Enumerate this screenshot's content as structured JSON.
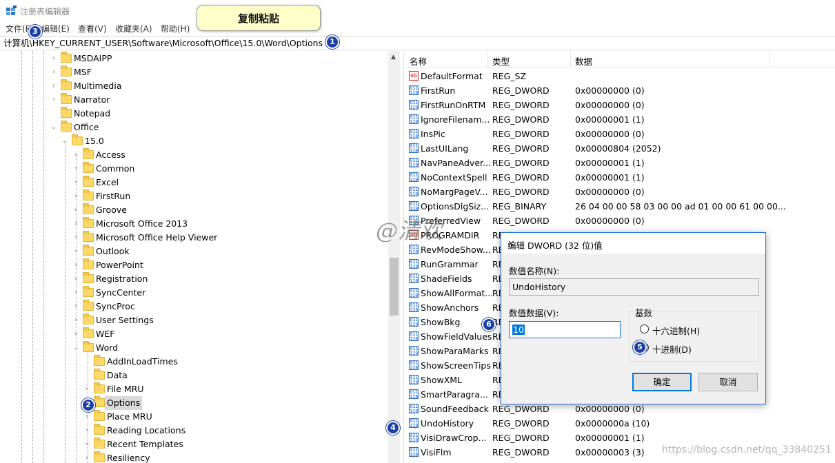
{
  "window": {
    "title": "注册表编辑器"
  },
  "menu": [
    "文件(F)",
    "编辑(E)",
    "查看(V)",
    "收藏夹(A)",
    "帮助(H)"
  ],
  "callout": "复制粘贴",
  "address": "计算机\\HKEY_CURRENT_USER\\Software\\Microsoft\\Office\\15.0\\Word\\Options",
  "tree": {
    "items": [
      {
        "label": "MSDAIPP",
        "level": 0,
        "expander": "›"
      },
      {
        "label": "MSF",
        "level": 0,
        "expander": "›"
      },
      {
        "label": "Multimedia",
        "level": 0,
        "expander": "›"
      },
      {
        "label": "Narrator",
        "level": 0,
        "expander": "›"
      },
      {
        "label": "Notepad",
        "level": 0,
        "expander": ""
      },
      {
        "label": "Office",
        "level": 0,
        "expander": "⌄"
      },
      {
        "label": "15.0",
        "level": 1,
        "expander": "⌄"
      },
      {
        "label": "Access",
        "level": 2,
        "expander": "›"
      },
      {
        "label": "Common",
        "level": 2,
        "expander": "›"
      },
      {
        "label": "Excel",
        "level": 2,
        "expander": "›"
      },
      {
        "label": "FirstRun",
        "level": 2,
        "expander": "›"
      },
      {
        "label": "Groove",
        "level": 2,
        "expander": "›"
      },
      {
        "label": "Microsoft Office 2013",
        "level": 2,
        "expander": "›"
      },
      {
        "label": "Microsoft Office Help Viewer",
        "level": 2,
        "expander": "›"
      },
      {
        "label": "Outlook",
        "level": 2,
        "expander": "›"
      },
      {
        "label": "PowerPoint",
        "level": 2,
        "expander": "›"
      },
      {
        "label": "Registration",
        "level": 2,
        "expander": "›"
      },
      {
        "label": "SyncCenter",
        "level": 2,
        "expander": "›"
      },
      {
        "label": "SyncProc",
        "level": 2,
        "expander": "›"
      },
      {
        "label": "User Settings",
        "level": 2,
        "expander": "›"
      },
      {
        "label": "WEF",
        "level": 2,
        "expander": "›"
      },
      {
        "label": "Word",
        "level": 2,
        "expander": "⌄"
      },
      {
        "label": "AddInLoadTimes",
        "level": 3,
        "expander": ""
      },
      {
        "label": "Data",
        "level": 3,
        "expander": ""
      },
      {
        "label": "File MRU",
        "level": 3,
        "expander": "›"
      },
      {
        "label": "Options",
        "level": 3,
        "expander": "",
        "selected": true
      },
      {
        "label": "Place MRU",
        "level": 3,
        "expander": "›"
      },
      {
        "label": "Reading Locations",
        "level": 3,
        "expander": "›"
      },
      {
        "label": "Recent Templates",
        "level": 3,
        "expander": "›"
      },
      {
        "label": "Resiliency",
        "level": 3,
        "expander": "›"
      }
    ]
  },
  "list": {
    "headers": {
      "name": "名称",
      "type": "类型",
      "data": "数据"
    },
    "rows": [
      {
        "name": "DefaultFormat",
        "type": "REG_SZ",
        "data": "",
        "icon": "sz"
      },
      {
        "name": "FirstRun",
        "type": "REG_DWORD",
        "data": "0x00000000 (0)",
        "icon": "dword"
      },
      {
        "name": "FirstRunOnRTM",
        "type": "REG_DWORD",
        "data": "0x00000000 (0)",
        "icon": "dword"
      },
      {
        "name": "IgnoreFilenam...",
        "type": "REG_DWORD",
        "data": "0x00000001 (1)",
        "icon": "dword"
      },
      {
        "name": "InsPic",
        "type": "REG_DWORD",
        "data": "0x00000000 (0)",
        "icon": "dword"
      },
      {
        "name": "LastUILang",
        "type": "REG_DWORD",
        "data": "0x00000804 (2052)",
        "icon": "dword"
      },
      {
        "name": "NavPaneAdver...",
        "type": "REG_DWORD",
        "data": "0x00000001 (1)",
        "icon": "dword"
      },
      {
        "name": "NoContextSpell",
        "type": "REG_DWORD",
        "data": "0x00000001 (1)",
        "icon": "dword"
      },
      {
        "name": "NoMargPageV...",
        "type": "REG_DWORD",
        "data": "0x00000000 (0)",
        "icon": "dword"
      },
      {
        "name": "OptionsDlgSiz...",
        "type": "REG_BINARY",
        "data": "26 04 00 00 58 03 00 00 ad 01 00 00 61 00 00...",
        "icon": "dword"
      },
      {
        "name": "PreferredView",
        "type": "REG_DWORD",
        "data": "0x00000000 (0)",
        "icon": "dword"
      },
      {
        "name": "PROGRAMDIR",
        "type": "RE",
        "data": "",
        "icon": "sz"
      },
      {
        "name": "RevModeShow...",
        "type": "RE",
        "data": "",
        "icon": "dword"
      },
      {
        "name": "RunGrammar",
        "type": "RE",
        "data": "",
        "icon": "dword"
      },
      {
        "name": "ShadeFields",
        "type": "RE",
        "data": "",
        "icon": "dword"
      },
      {
        "name": "ShowAllFormat...",
        "type": "RE",
        "data": "",
        "icon": "dword"
      },
      {
        "name": "ShowAnchors",
        "type": "RE",
        "data": "",
        "icon": "dword"
      },
      {
        "name": "ShowBkg",
        "type": "RE",
        "data": "",
        "icon": "dword"
      },
      {
        "name": "ShowFieldValues",
        "type": "RE",
        "data": "",
        "icon": "dword"
      },
      {
        "name": "ShowParaMarks",
        "type": "RE",
        "data": "",
        "icon": "dword"
      },
      {
        "name": "ShowScreenTips",
        "type": "RE",
        "data": "",
        "icon": "dword"
      },
      {
        "name": "ShowXML",
        "type": "RE",
        "data": "",
        "icon": "dword"
      },
      {
        "name": "SmartParagra...",
        "type": "RE",
        "data": "",
        "icon": "dword"
      },
      {
        "name": "SoundFeedback",
        "type": "REG_DWORD",
        "data": "0x00000000 (0)",
        "icon": "dword"
      },
      {
        "name": "UndoHistory",
        "type": "REG_DWORD",
        "data": "0x0000000a (10)",
        "icon": "dword"
      },
      {
        "name": "VisiDrawCrop...",
        "type": "REG_DWORD",
        "data": "0x00000001 (1)",
        "icon": "dword"
      },
      {
        "name": "VisiFlm",
        "type": "REG_DWORD",
        "data": "0x00000003 (3)",
        "icon": "dword"
      }
    ]
  },
  "dialog": {
    "title": "编辑 DWORD (32 位)值",
    "name_label": "数值名称(N):",
    "name_value": "UndoHistory",
    "data_label": "数值数据(V):",
    "data_value": "10",
    "base_label": "基数",
    "radio_hex": "十六进制(H)",
    "radio_dec": "十进制(D)",
    "selected_base": "decimal",
    "ok": "确定",
    "cancel": "取消",
    "close": "✕"
  },
  "badges": [
    "1",
    "2",
    "3",
    "4",
    "5",
    "6"
  ],
  "watermarks": {
    "center": "@清欢",
    "footer": "https://blog.csdn.net/qq_33840251"
  }
}
